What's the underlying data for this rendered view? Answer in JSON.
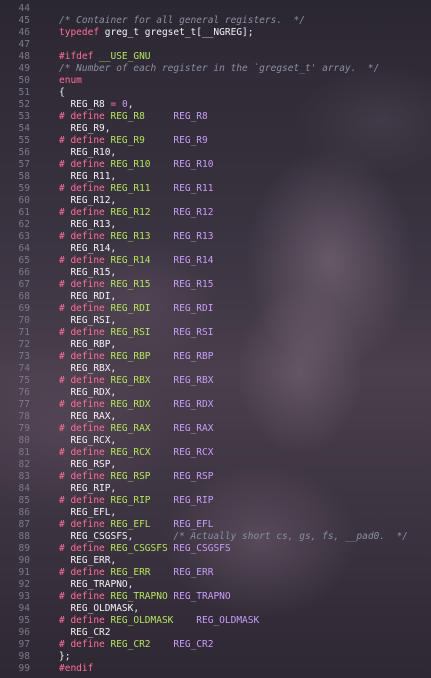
{
  "editor": {
    "lines": [
      {
        "n": "44",
        "tokens": []
      },
      {
        "n": "45",
        "tokens": [
          {
            "t": "/* Container for all general registers.  */",
            "c": "comment"
          }
        ]
      },
      {
        "n": "46",
        "tokens": [
          {
            "t": "typedef",
            "c": "kw"
          },
          {
            "t": " greg_t gregset_t[__NGREG];",
            "c": "plain"
          }
        ]
      },
      {
        "n": "47",
        "tokens": []
      },
      {
        "n": "48",
        "tokens": [
          {
            "t": "#ifdef",
            "c": "kw"
          },
          {
            "t": " __USE_GNU",
            "c": "macro"
          }
        ]
      },
      {
        "n": "49",
        "tokens": [
          {
            "t": "/* Number of each register in the `gregset_t' array.  */",
            "c": "comment"
          }
        ]
      },
      {
        "n": "50",
        "tokens": [
          {
            "t": "enum",
            "c": "kw"
          }
        ]
      },
      {
        "n": "51",
        "tokens": [
          {
            "t": "{",
            "c": "plain"
          }
        ]
      },
      {
        "n": "52",
        "tokens": [
          {
            "t": "  REG_R8 ",
            "c": "plain"
          },
          {
            "t": "=",
            "c": "kw"
          },
          {
            "t": " ",
            "c": "plain"
          },
          {
            "t": "0",
            "c": "num"
          },
          {
            "t": ",",
            "c": "plain"
          }
        ]
      },
      {
        "n": "53",
        "tokens": [
          {
            "t": "# define",
            "c": "kw"
          },
          {
            "t": " REG_R8     ",
            "c": "macro"
          },
          {
            "t": "REG_R8",
            "c": "enum"
          }
        ]
      },
      {
        "n": "54",
        "tokens": [
          {
            "t": "  REG_R9,",
            "c": "plain"
          }
        ]
      },
      {
        "n": "55",
        "tokens": [
          {
            "t": "# define",
            "c": "kw"
          },
          {
            "t": " REG_R9     ",
            "c": "macro"
          },
          {
            "t": "REG_R9",
            "c": "enum"
          }
        ]
      },
      {
        "n": "56",
        "tokens": [
          {
            "t": "  REG_R10,",
            "c": "plain"
          }
        ]
      },
      {
        "n": "57",
        "tokens": [
          {
            "t": "# define",
            "c": "kw"
          },
          {
            "t": " REG_R10    ",
            "c": "macro"
          },
          {
            "t": "REG_R10",
            "c": "enum"
          }
        ]
      },
      {
        "n": "58",
        "tokens": [
          {
            "t": "  REG_R11,",
            "c": "plain"
          }
        ]
      },
      {
        "n": "59",
        "tokens": [
          {
            "t": "# define",
            "c": "kw"
          },
          {
            "t": " REG_R11    ",
            "c": "macro"
          },
          {
            "t": "REG_R11",
            "c": "enum"
          }
        ]
      },
      {
        "n": "60",
        "tokens": [
          {
            "t": "  REG_R12,",
            "c": "plain"
          }
        ]
      },
      {
        "n": "61",
        "tokens": [
          {
            "t": "# define",
            "c": "kw"
          },
          {
            "t": " REG_R12    ",
            "c": "macro"
          },
          {
            "t": "REG_R12",
            "c": "enum"
          }
        ]
      },
      {
        "n": "62",
        "tokens": [
          {
            "t": "  REG_R13,",
            "c": "plain"
          }
        ]
      },
      {
        "n": "63",
        "tokens": [
          {
            "t": "# define",
            "c": "kw"
          },
          {
            "t": " REG_R13    ",
            "c": "macro"
          },
          {
            "t": "REG_R13",
            "c": "enum"
          }
        ]
      },
      {
        "n": "64",
        "tokens": [
          {
            "t": "  REG_R14,",
            "c": "plain"
          }
        ]
      },
      {
        "n": "65",
        "tokens": [
          {
            "t": "# define",
            "c": "kw"
          },
          {
            "t": " REG_R14    ",
            "c": "macro"
          },
          {
            "t": "REG_R14",
            "c": "enum"
          }
        ]
      },
      {
        "n": "66",
        "tokens": [
          {
            "t": "  REG_R15,",
            "c": "plain"
          }
        ]
      },
      {
        "n": "67",
        "tokens": [
          {
            "t": "# define",
            "c": "kw"
          },
          {
            "t": " REG_R15    ",
            "c": "macro"
          },
          {
            "t": "REG_R15",
            "c": "enum"
          }
        ]
      },
      {
        "n": "68",
        "tokens": [
          {
            "t": "  REG_RDI,",
            "c": "plain"
          }
        ]
      },
      {
        "n": "69",
        "tokens": [
          {
            "t": "# define",
            "c": "kw"
          },
          {
            "t": " REG_RDI    ",
            "c": "macro"
          },
          {
            "t": "REG_RDI",
            "c": "enum"
          }
        ]
      },
      {
        "n": "70",
        "tokens": [
          {
            "t": "  REG_RSI,",
            "c": "plain"
          }
        ]
      },
      {
        "n": "71",
        "tokens": [
          {
            "t": "# define",
            "c": "kw"
          },
          {
            "t": " REG_RSI    ",
            "c": "macro"
          },
          {
            "t": "REG_RSI",
            "c": "enum"
          }
        ]
      },
      {
        "n": "72",
        "tokens": [
          {
            "t": "  REG_RBP,",
            "c": "plain"
          }
        ]
      },
      {
        "n": "73",
        "tokens": [
          {
            "t": "# define",
            "c": "kw"
          },
          {
            "t": " REG_RBP    ",
            "c": "macro"
          },
          {
            "t": "REG_RBP",
            "c": "enum"
          }
        ]
      },
      {
        "n": "74",
        "tokens": [
          {
            "t": "  REG_RBX,",
            "c": "plain"
          }
        ]
      },
      {
        "n": "75",
        "tokens": [
          {
            "t": "# define",
            "c": "kw"
          },
          {
            "t": " REG_RBX    ",
            "c": "macro"
          },
          {
            "t": "REG_RBX",
            "c": "enum"
          }
        ]
      },
      {
        "n": "76",
        "tokens": [
          {
            "t": "  REG_RDX,",
            "c": "plain"
          }
        ]
      },
      {
        "n": "77",
        "tokens": [
          {
            "t": "# define",
            "c": "kw"
          },
          {
            "t": " REG_RDX    ",
            "c": "macro"
          },
          {
            "t": "REG_RDX",
            "c": "enum"
          }
        ]
      },
      {
        "n": "78",
        "tokens": [
          {
            "t": "  REG_RAX,",
            "c": "plain"
          }
        ]
      },
      {
        "n": "79",
        "tokens": [
          {
            "t": "# define",
            "c": "kw"
          },
          {
            "t": " REG_RAX    ",
            "c": "macro"
          },
          {
            "t": "REG_RAX",
            "c": "enum"
          }
        ]
      },
      {
        "n": "80",
        "tokens": [
          {
            "t": "  REG_RCX,",
            "c": "plain"
          }
        ]
      },
      {
        "n": "81",
        "tokens": [
          {
            "t": "# define",
            "c": "kw"
          },
          {
            "t": " REG_RCX    ",
            "c": "macro"
          },
          {
            "t": "REG_RCX",
            "c": "enum"
          }
        ]
      },
      {
        "n": "82",
        "tokens": [
          {
            "t": "  REG_RSP,",
            "c": "plain"
          }
        ]
      },
      {
        "n": "83",
        "tokens": [
          {
            "t": "# define",
            "c": "kw"
          },
          {
            "t": " REG_RSP    ",
            "c": "macro"
          },
          {
            "t": "REG_RSP",
            "c": "enum"
          }
        ]
      },
      {
        "n": "84",
        "tokens": [
          {
            "t": "  REG_RIP,",
            "c": "plain"
          }
        ]
      },
      {
        "n": "85",
        "tokens": [
          {
            "t": "# define",
            "c": "kw"
          },
          {
            "t": " REG_RIP    ",
            "c": "macro"
          },
          {
            "t": "REG_RIP",
            "c": "enum"
          }
        ]
      },
      {
        "n": "86",
        "tokens": [
          {
            "t": "  REG_EFL,",
            "c": "plain"
          }
        ]
      },
      {
        "n": "87",
        "tokens": [
          {
            "t": "# define",
            "c": "kw"
          },
          {
            "t": " REG_EFL    ",
            "c": "macro"
          },
          {
            "t": "REG_EFL",
            "c": "enum"
          }
        ]
      },
      {
        "n": "88",
        "tokens": [
          {
            "t": "  REG_CSGSFS,       ",
            "c": "plain"
          },
          {
            "t": "/* Actually short cs, gs, fs, __pad0.  */",
            "c": "comment"
          }
        ]
      },
      {
        "n": "89",
        "tokens": [
          {
            "t": "# define",
            "c": "kw"
          },
          {
            "t": " REG_CSGSFS ",
            "c": "macro"
          },
          {
            "t": "REG_CSGSFS",
            "c": "enum"
          }
        ]
      },
      {
        "n": "90",
        "tokens": [
          {
            "t": "  REG_ERR,",
            "c": "plain"
          }
        ]
      },
      {
        "n": "91",
        "tokens": [
          {
            "t": "# define",
            "c": "kw"
          },
          {
            "t": " REG_ERR    ",
            "c": "macro"
          },
          {
            "t": "REG_ERR",
            "c": "enum"
          }
        ]
      },
      {
        "n": "92",
        "tokens": [
          {
            "t": "  REG_TRAPNO,",
            "c": "plain"
          }
        ]
      },
      {
        "n": "93",
        "tokens": [
          {
            "t": "# define",
            "c": "kw"
          },
          {
            "t": " REG_TRAPNO ",
            "c": "macro"
          },
          {
            "t": "REG_TRAPNO",
            "c": "enum"
          }
        ]
      },
      {
        "n": "94",
        "tokens": [
          {
            "t": "  REG_OLDMASK,",
            "c": "plain"
          }
        ]
      },
      {
        "n": "95",
        "tokens": [
          {
            "t": "# define",
            "c": "kw"
          },
          {
            "t": " REG_OLDMASK    ",
            "c": "macro"
          },
          {
            "t": "REG_OLDMASK",
            "c": "enum"
          }
        ]
      },
      {
        "n": "96",
        "tokens": [
          {
            "t": "  REG_CR2",
            "c": "plain"
          }
        ]
      },
      {
        "n": "97",
        "tokens": [
          {
            "t": "# define",
            "c": "kw"
          },
          {
            "t": " REG_CR2    ",
            "c": "macro"
          },
          {
            "t": "REG_CR2",
            "c": "enum"
          }
        ]
      },
      {
        "n": "98",
        "tokens": [
          {
            "t": "};",
            "c": "plain"
          }
        ]
      },
      {
        "n": "99",
        "tokens": [
          {
            "t": "#endif",
            "c": "kw"
          }
        ]
      }
    ]
  }
}
